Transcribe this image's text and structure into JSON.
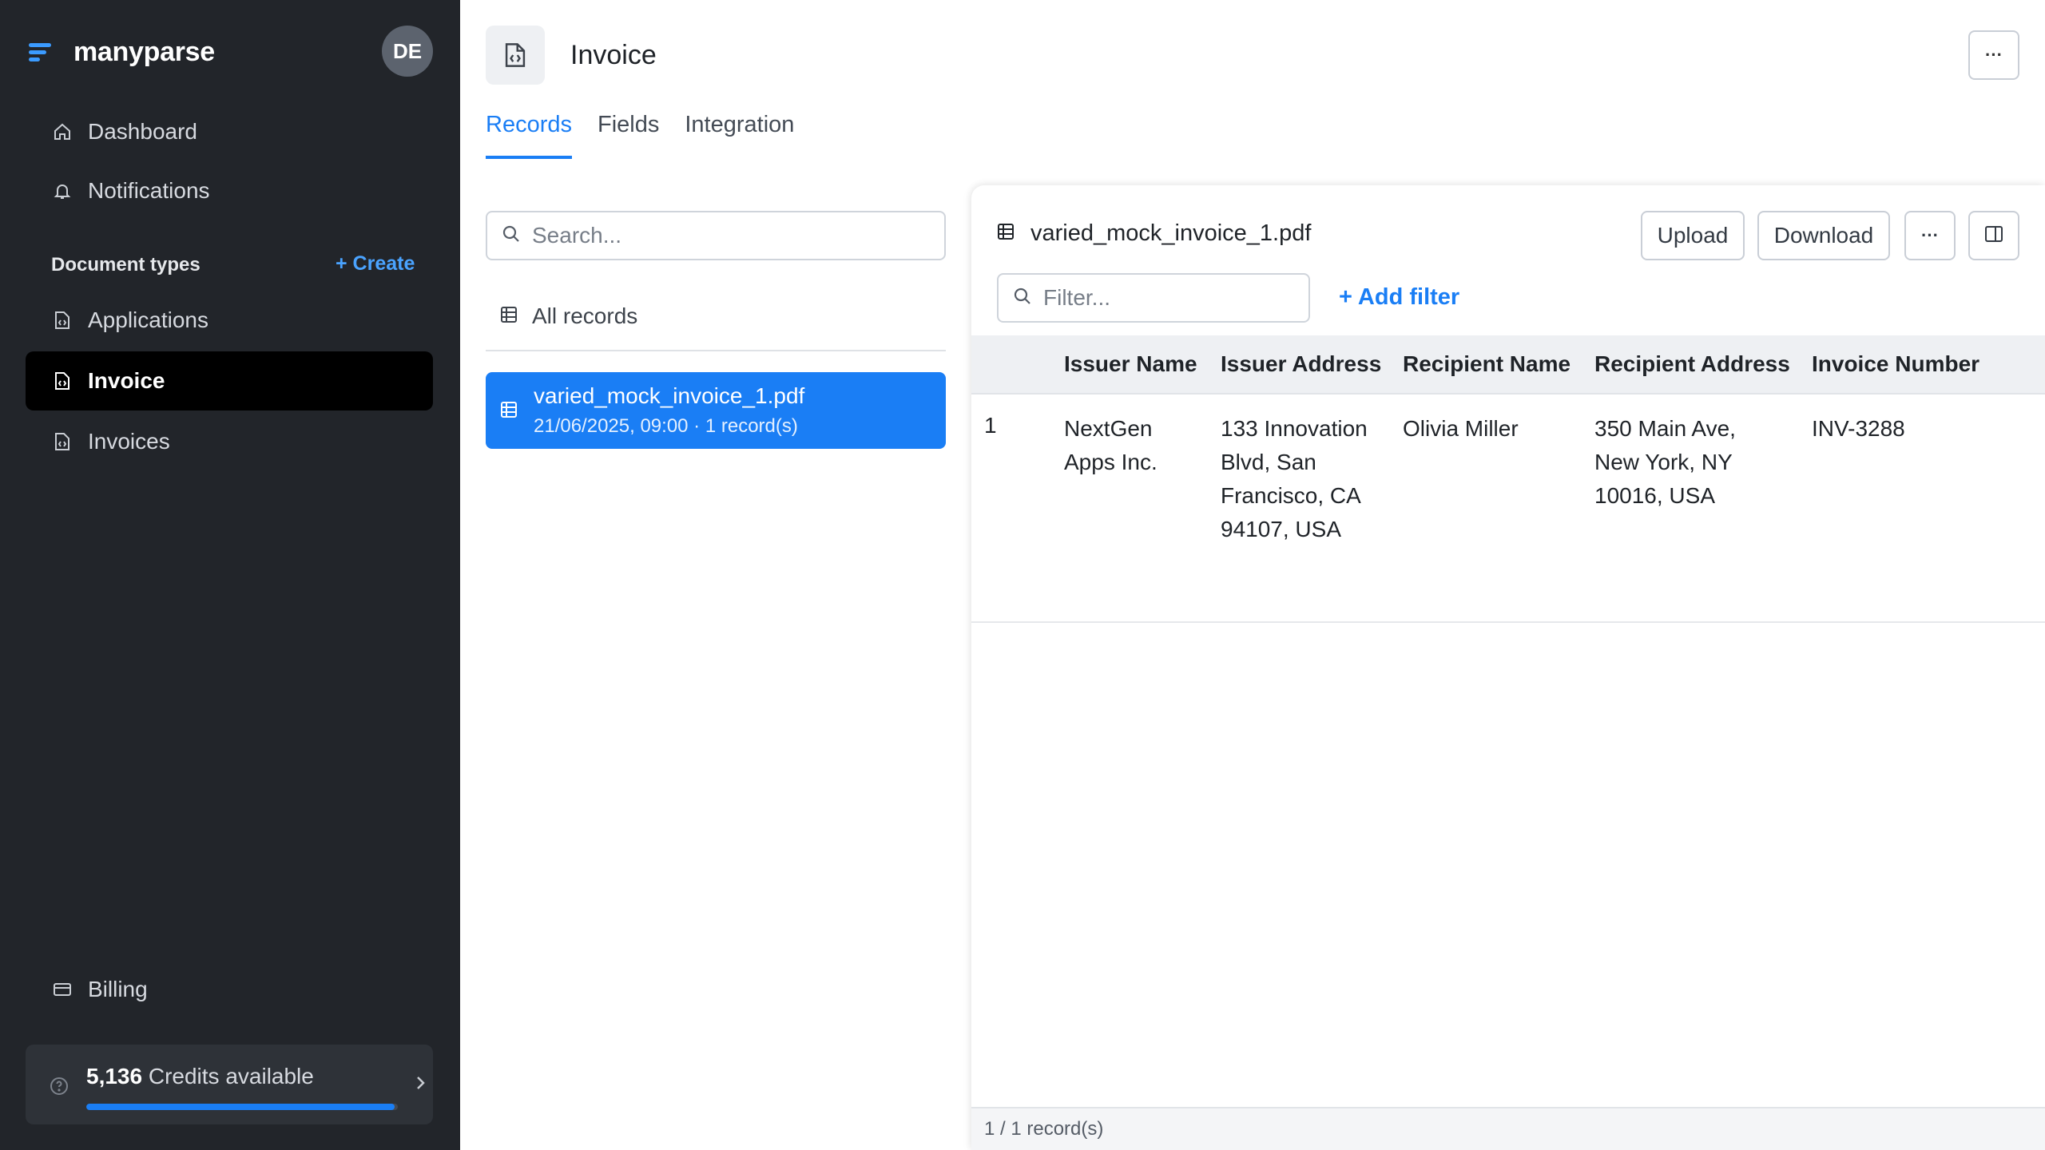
{
  "brand": {
    "name": "manyparse"
  },
  "user": {
    "initials": "DE"
  },
  "sidebar": {
    "nav": [
      {
        "label": "Dashboard",
        "icon": "home-icon"
      },
      {
        "label": "Notifications",
        "icon": "bell-icon"
      }
    ],
    "section_label": "Document types",
    "create_label": "Create",
    "doc_types": [
      {
        "label": "Applications",
        "icon": "file-icon"
      },
      {
        "label": "Invoice",
        "icon": "file-icon",
        "active": true
      },
      {
        "label": "Invoices",
        "icon": "file-icon"
      }
    ],
    "billing_label": "Billing",
    "credits": {
      "amount": "5,136",
      "label": "Credits available",
      "fill_fraction": 0.99
    }
  },
  "header": {
    "title": "Invoice",
    "tabs": [
      {
        "label": "Records",
        "active": true
      },
      {
        "label": "Fields"
      },
      {
        "label": "Integration"
      }
    ]
  },
  "records": {
    "search_placeholder": "Search...",
    "all_records_label": "All records",
    "items": [
      {
        "title": "varied_mock_invoice_1.pdf",
        "subtitle": "21/06/2025, 09:00 · 1 record(s)",
        "selected": true
      }
    ]
  },
  "detail": {
    "file_name": "varied_mock_invoice_1.pdf",
    "upload_label": "Upload",
    "download_label": "Download",
    "filter_placeholder": "Filter...",
    "add_filter_label": "Add filter",
    "columns": [
      "Issuer Name",
      "Issuer Address",
      "Recipient Name",
      "Recipient Address",
      "Invoice Number"
    ],
    "rows": [
      {
        "index": "1",
        "issuer_name": [
          "NextGen",
          "Apps Inc."
        ],
        "issuer_address": [
          "133 Innovation",
          "Blvd, San",
          "Francisco, CA",
          "94107, USA"
        ],
        "recipient_name": [
          "Olivia Miller"
        ],
        "recipient_address": [
          "350 Main Ave,",
          "New York, NY",
          "10016, USA"
        ],
        "invoice_number": [
          "INV-3288"
        ]
      }
    ],
    "status": "1 / 1 record(s)"
  },
  "colors": {
    "accent": "#1a7ef5",
    "sidebar_bg": "#22252a"
  }
}
